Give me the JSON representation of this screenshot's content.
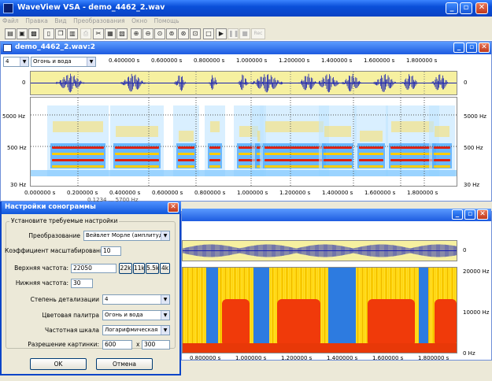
{
  "app": {
    "title": "WaveView VSA - demo_4462_2.wav",
    "icon": "app-icon",
    "caption_buttons": [
      "_",
      "▫",
      "✕"
    ]
  },
  "menu": [
    "Файл",
    "Правка",
    "Вид",
    "Преобразования",
    "Окно",
    "Помощь"
  ],
  "toolbar": {
    "disabled_label": "Rec"
  },
  "window1": {
    "title": "demo_4462_2.wav:2",
    "level_value": "4",
    "palette_value": "Огонь и вода",
    "time_ticks_top": [
      "0.400000 s",
      "0.600000 s",
      "0.800000 s",
      "1.000000 s",
      "1.200000 s",
      "1.400000 s",
      "1.600000 s",
      "1.800000 s"
    ],
    "time_ticks_bottom": [
      "0.000000 s",
      "0.200000 s",
      "0.400000 s",
      "0.600000 s",
      "0.800000 s",
      "1.000000 s",
      "1.200000 s",
      "1.400000 s",
      "1.600000 s",
      "1.800000 s"
    ],
    "wave_zero": "0",
    "freq_labels": [
      "5000 Hz",
      "500 Hz",
      "30 Hz"
    ],
    "partial_readout": "0.1234 ... 5700 Hz"
  },
  "window2": {
    "wave_zero": "0",
    "freq_labels": [
      "20000 Hz",
      "10000 Hz",
      "0 Hz"
    ],
    "time_ticks_bottom": [
      "0.800000 s",
      "1.000000 s",
      "1.200000 s",
      "1.400000 s",
      "1.600000 s",
      "1.800000 s"
    ]
  },
  "dialog": {
    "title": "Настройки сонограммы",
    "group_label": "Установите требуемые настройки",
    "transform_label": "Преобразование",
    "transform_value": "Вейвлет Морле (амплитуда)",
    "scale_label": "Коэффициент масштабирования",
    "scale_value": "10",
    "upper_label": "Верхняя частота:",
    "upper_value": "22050",
    "presets": [
      "22k",
      "11k",
      "5.5k",
      "4k"
    ],
    "lower_label": "Нижняя частота:",
    "lower_value": "30",
    "detail_label": "Степень детализации",
    "detail_value": "4",
    "palette_label": "Цветовая палитра",
    "palette_value": "Огонь и вода",
    "freqscale_label": "Частотная шкала",
    "freqscale_value": "Логарифмическая",
    "resolution_label": "Разрешение картинки:",
    "res_w": "600",
    "res_x": "x",
    "res_h": "300",
    "ok_label": "OK",
    "cancel_label": "Отмена"
  },
  "colors": {
    "title_blue": "#0b4fd9",
    "wave_bg": "#f6f0a0",
    "spectro_bg": "#ffffff",
    "wave_color": "#1a22b0"
  }
}
